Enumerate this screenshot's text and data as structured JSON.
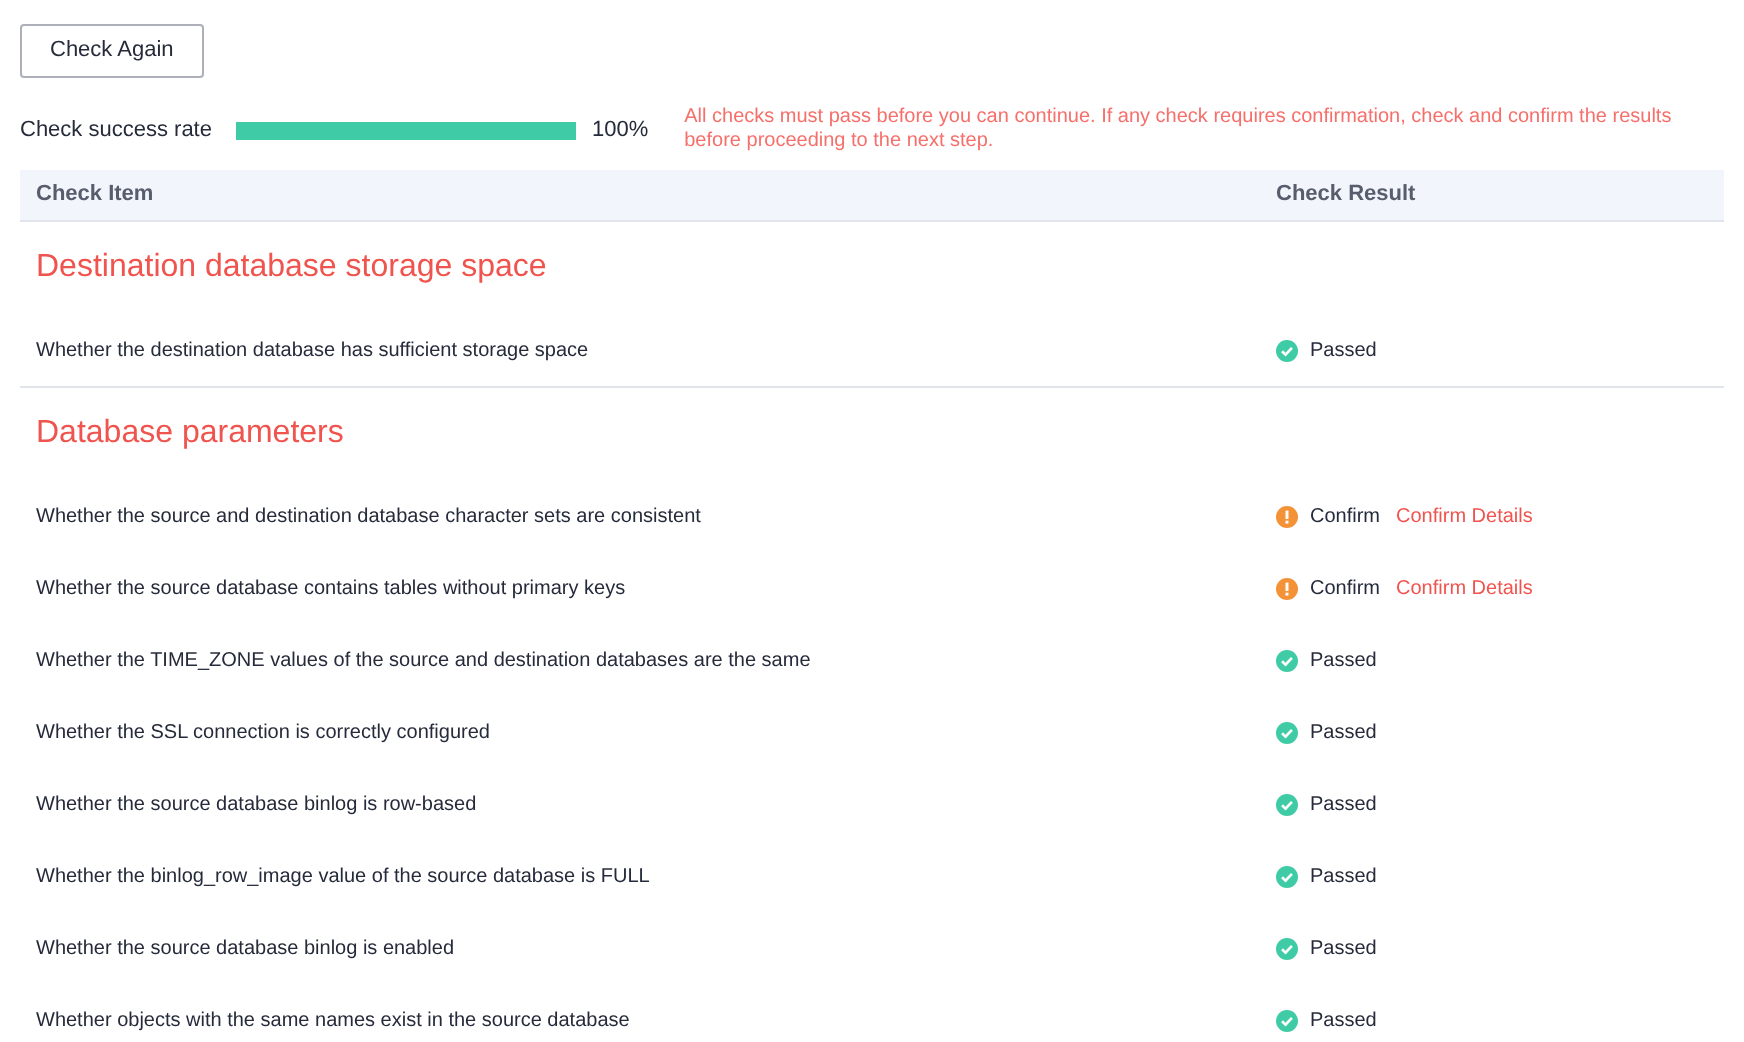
{
  "check_again_button": "Check Again",
  "progress": {
    "label": "Check success rate",
    "level": 1,
    "reading": "100%"
  },
  "notice": "All checks must pass before you can continue. If any check requires confirmation, check and confirm the results before proceeding to the next step.",
  "table": {
    "columns": [
      "Check Item",
      "Check Result"
    ],
    "groups": [
      {
        "title": "Destination database storage space",
        "rows": [
          {
            "item": "Whether the destination database has sufficient storage space",
            "kind": "passed",
            "result": "Passed"
          }
        ]
      },
      {
        "title": "Database parameters",
        "rows": [
          {
            "item": "Whether the source and destination database character sets are consistent",
            "kind": "confirm",
            "result": "Confirm",
            "link": "Confirm Details"
          },
          {
            "item": "Whether the source database contains tables without primary keys",
            "kind": "confirm",
            "result": "Confirm",
            "link": "Confirm Details"
          },
          {
            "item": "Whether the TIME_ZONE values of the source and destination databases are the same",
            "kind": "passed",
            "result": "Passed"
          },
          {
            "item": "Whether the SSL connection is correctly configured",
            "kind": "passed",
            "result": "Passed"
          },
          {
            "item": "Whether the source database binlog is row-based",
            "kind": "passed",
            "result": "Passed"
          },
          {
            "item": "Whether the binlog_row_image value of the source database is FULL",
            "kind": "passed",
            "result": "Passed"
          },
          {
            "item": "Whether the source database binlog is enabled",
            "kind": "passed",
            "result": "Passed"
          },
          {
            "item": "Whether objects with the same names exist in the source database",
            "kind": "passed",
            "result": "Passed"
          }
        ]
      }
    ]
  }
}
